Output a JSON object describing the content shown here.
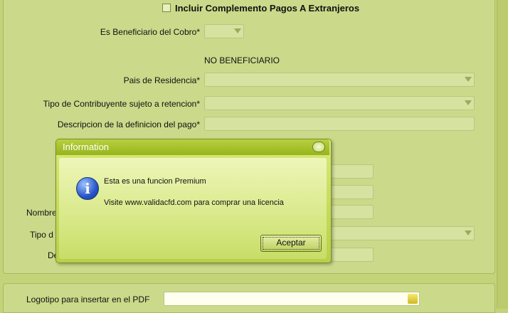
{
  "form": {
    "complemento_checkbox": "Incluir Complemento Pagos A Extranjeros",
    "es_beneficiario_label": "Es Beneficiario del Cobro*",
    "no_beneficiario_header": "NO BENEFICIARIO",
    "pais_label": "Pais de Residencia*",
    "tipo_contribuyente_label": "Tipo de Contribuyente sujeto a retencion*",
    "descripcion_label": "Descripcion de la definicion del pago*",
    "nombre_label_partial": "Nombre",
    "tipo_label_partial": "Tipo d",
    "de_label_partial": "De",
    "logotipo_label": "Logotipo para insertar en el PDF"
  },
  "dialog": {
    "title": "Information",
    "message_line1": "Esta es una funcion Premium",
    "message_line2": "Visite www.validacfd.com para comprar una licencia",
    "ok_button": "Aceptar"
  }
}
